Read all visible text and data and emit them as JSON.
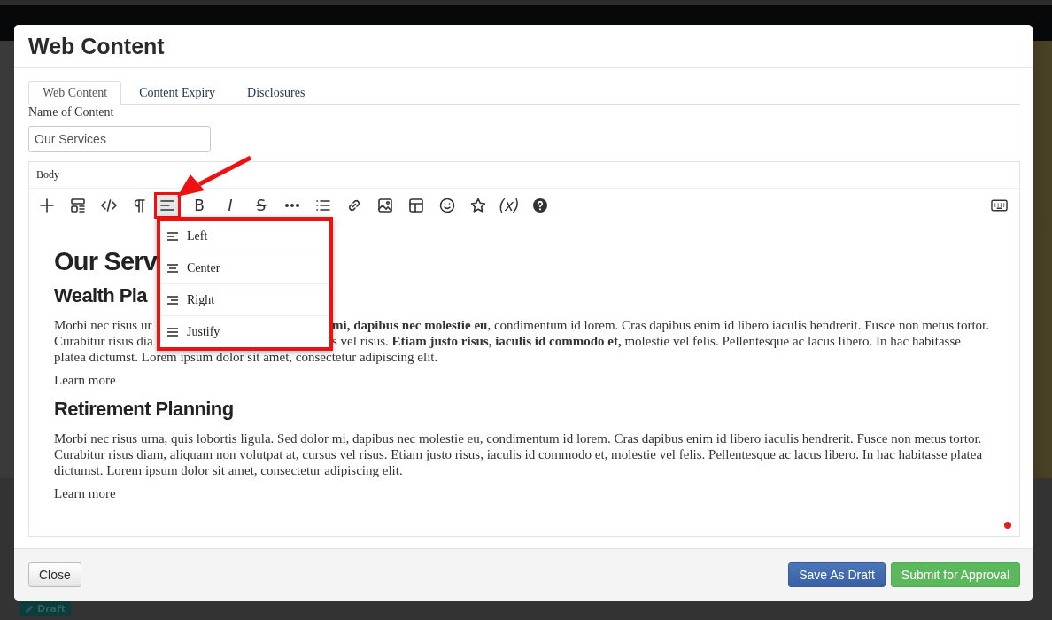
{
  "background_badge": "Draft",
  "dialog": {
    "title": "Web Content",
    "tabs": [
      {
        "label": "Web Content",
        "selected": true
      },
      {
        "label": "Content Expiry",
        "selected": false
      },
      {
        "label": "Disclosures",
        "selected": false
      }
    ],
    "name_field": {
      "label": "Name of Content",
      "value": "Our Services"
    },
    "editor": {
      "label": "Body",
      "toolbar": [
        {
          "kind": "plus",
          "selected": false
        },
        {
          "kind": "template",
          "selected": false
        },
        {
          "kind": "code",
          "selected": false
        },
        {
          "kind": "paragraph",
          "selected": false
        },
        {
          "kind": "align",
          "selected": true
        },
        {
          "kind": "bold",
          "glyph": "B",
          "selected": false
        },
        {
          "kind": "italic",
          "glyph": "I",
          "selected": false
        },
        {
          "kind": "strike",
          "glyph": "S",
          "selected": false
        },
        {
          "kind": "more",
          "selected": false
        },
        {
          "kind": "list",
          "selected": false
        },
        {
          "kind": "link",
          "selected": false
        },
        {
          "kind": "image",
          "selected": false
        },
        {
          "kind": "table",
          "selected": false
        },
        {
          "kind": "emoji",
          "selected": false
        },
        {
          "kind": "star",
          "selected": false
        },
        {
          "kind": "variable",
          "glyph": "(x)",
          "selected": false
        },
        {
          "kind": "help",
          "selected": false
        }
      ],
      "align_menu": [
        {
          "kind": "left",
          "label": "Left"
        },
        {
          "kind": "center",
          "label": "Center"
        },
        {
          "kind": "right",
          "label": "Right"
        },
        {
          "kind": "justify",
          "label": "Justify"
        }
      ],
      "content": [
        {
          "kind": "heading1",
          "text": "Our Serv"
        },
        {
          "kind": "heading2",
          "text": "Wealth Pla"
        },
        {
          "kind": "split_paragraph",
          "lines": [
            [
              "Morbi nec risus ur",
              "**mi, dapibus nec molestie eu**, condimentum id lorem. Cras dapibus enim id libero iaculis hendrerit. Fusce non metus tortor."
            ],
            [
              "Curabitur risus dia",
              "s vel risus. **Etiam justo risus, iaculis id commodo et,** molestie vel felis. Pellentesque ac lacus libero. In hac habitasse"
            ],
            [
              "platea dictumst. Lorem ipsum dolor sit amet, consectetur adipiscing elit."
            ]
          ]
        },
        {
          "kind": "text",
          "text": "Learn more"
        },
        {
          "kind": "heading2",
          "text": "Retirement Planning"
        },
        {
          "kind": "paragraph",
          "text": "Morbi nec risus urna, quis lobortis ligula. Sed dolor mi, dapibus nec molestie eu, condimentum id lorem. Cras dapibus enim id libero iaculis hendrerit. Fusce non metus tortor. Curabitur risus diam, aliquam non volutpat at, cursus vel risus. Etiam justo risus, iaculis id commodo et, molestie vel felis. Pellentesque ac lacus libero. In hac habitasse platea dictumst. Lorem ipsum dolor sit amet, consectetur adipiscing elit."
        },
        {
          "kind": "text",
          "text": "Learn more"
        }
      ]
    },
    "buttons": [
      {
        "kind": "default",
        "label": "Close"
      },
      {
        "kind": "primary",
        "label": "Save As Draft"
      },
      {
        "kind": "success",
        "label": "Submit for Approval"
      }
    ]
  }
}
